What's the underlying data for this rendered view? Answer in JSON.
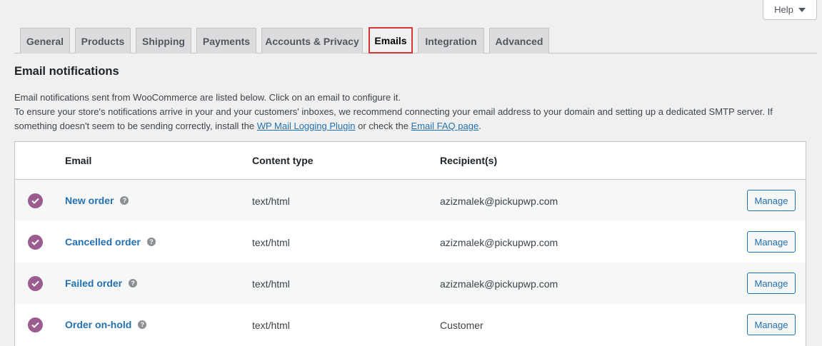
{
  "header": {
    "help_label": "Help"
  },
  "tabs": [
    {
      "label": "General",
      "active": false
    },
    {
      "label": "Products",
      "active": false
    },
    {
      "label": "Shipping",
      "active": false
    },
    {
      "label": "Payments",
      "active": false
    },
    {
      "label": "Accounts & Privacy",
      "active": false
    },
    {
      "label": "Emails",
      "active": true
    },
    {
      "label": "Integration",
      "active": false
    },
    {
      "label": "Advanced",
      "active": false
    }
  ],
  "section": {
    "title": "Email notifications",
    "line1": "Email notifications sent from WooCommerce are listed below. Click on an email to configure it.",
    "line2_a": "To ensure your store's notifications arrive in your and your customers' inboxes, we recommend connecting your email address to your domain and setting up a dedicated SMTP server. If something doesn't seem to be sending correctly, install the ",
    "link1": "WP Mail Logging Plugin",
    "line2_b": " or check the ",
    "link2": "Email FAQ page",
    "line2_c": "."
  },
  "table": {
    "headers": {
      "email": "Email",
      "content_type": "Content type",
      "recipients": "Recipient(s)"
    },
    "rows": [
      {
        "name": "New order",
        "content_type": "text/html",
        "recipient": "azizmalek@pickupwp.com",
        "action": "Manage"
      },
      {
        "name": "Cancelled order",
        "content_type": "text/html",
        "recipient": "azizmalek@pickupwp.com",
        "action": "Manage"
      },
      {
        "name": "Failed order",
        "content_type": "text/html",
        "recipient": "azizmalek@pickupwp.com",
        "action": "Manage"
      },
      {
        "name": "Order on-hold",
        "content_type": "text/html",
        "recipient": "Customer",
        "action": "Manage"
      }
    ],
    "help_tip_glyph": "?"
  },
  "colors": {
    "accent": "#2271b1",
    "check": "#9b5c8f",
    "active_tab_border": "#d63638"
  }
}
